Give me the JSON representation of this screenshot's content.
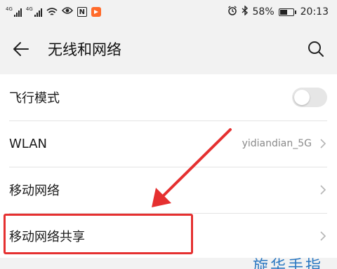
{
  "status_bar": {
    "sim1_tag": "4G",
    "sim2_tag": "4G",
    "icons": [
      "signal-icon",
      "signal-icon",
      "wifi-icon",
      "eye-icon",
      "nfc-icon",
      "app-notification-icon",
      "alarm-icon",
      "bluetooth-icon",
      "battery-icon"
    ],
    "nfc_letter": "N",
    "battery_percent": "58%",
    "battery_level": 0.58,
    "time": "20:13"
  },
  "toolbar": {
    "back_icon": "arrow-left-icon",
    "title": "无线和网络",
    "search_icon": "search-icon"
  },
  "settings": {
    "items": [
      {
        "label": "飞行模式",
        "control": "toggle",
        "toggle_on": false
      },
      {
        "label": "WLAN",
        "value": "yidiandian_5G",
        "control": "chevron"
      },
      {
        "label": "移动网络",
        "control": "chevron"
      },
      {
        "label": "移动网络共享",
        "control": "chevron",
        "highlighted": true
      }
    ]
  },
  "annotation": {
    "arrow_color": "#e53030",
    "box_color": "#e53030"
  },
  "bottom_peek_text": "旋华手指"
}
